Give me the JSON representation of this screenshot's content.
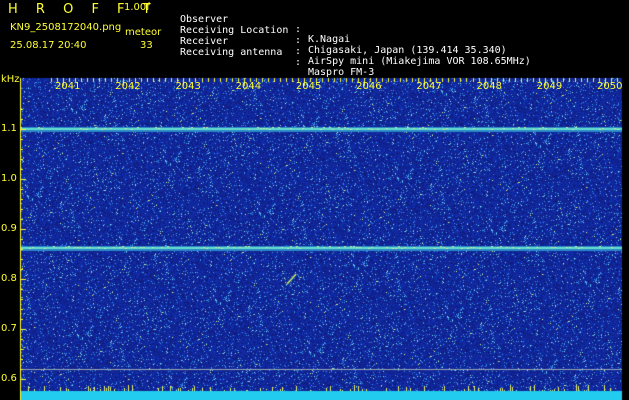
{
  "header": {
    "app_name": "H R O F F T",
    "version": "1.00f",
    "filename": "KN9_2508172040.png",
    "datetime": "25.08.17 20:40",
    "meteor_label": "meteor",
    "meteor_count": "33"
  },
  "meta": [
    {
      "key": "Observer",
      "value": "K.Nagai"
    },
    {
      "key": "Receiving Location",
      "value": "Chigasaki, Japan (139.414 35.340)"
    },
    {
      "key": "Receiver",
      "value": "AirSpy mini (Miakejima VOR 108.65MHz)"
    },
    {
      "key": "Receiving antenna",
      "value": "Maspro FM-3"
    }
  ],
  "meta_colon": ":",
  "y_unit": "kHz",
  "colors": {
    "background": "#000000",
    "label_yellow": "#ffff33",
    "noise_base": "#1a2a9a",
    "signal_line": "#66ddcc",
    "floor_band": "#22ccee"
  },
  "chart_data": {
    "type": "heatmap",
    "x_ticks": [
      "2041",
      "2042",
      "2043",
      "2044",
      "2045",
      "2046",
      "2047",
      "2048",
      "2049",
      "2050"
    ],
    "y_ticks": [
      "1.1",
      "1.0",
      "0.9",
      "0.8",
      "0.7",
      "0.6"
    ],
    "y_range_khz": [
      0.6,
      1.15
    ],
    "x_range": [
      2040.75,
      2050.25
    ],
    "signals": [
      {
        "kind": "carrier",
        "freq_khz": 1.1
      },
      {
        "kind": "carrier",
        "freq_khz": 0.862
      },
      {
        "kind": "reference",
        "freq_khz": 0.62
      },
      {
        "kind": "meteor_echo",
        "time": 2044.72,
        "freq_khz": 0.79,
        "end_time": 2044.87,
        "end_freq_khz": 0.81
      }
    ],
    "grid": true
  }
}
